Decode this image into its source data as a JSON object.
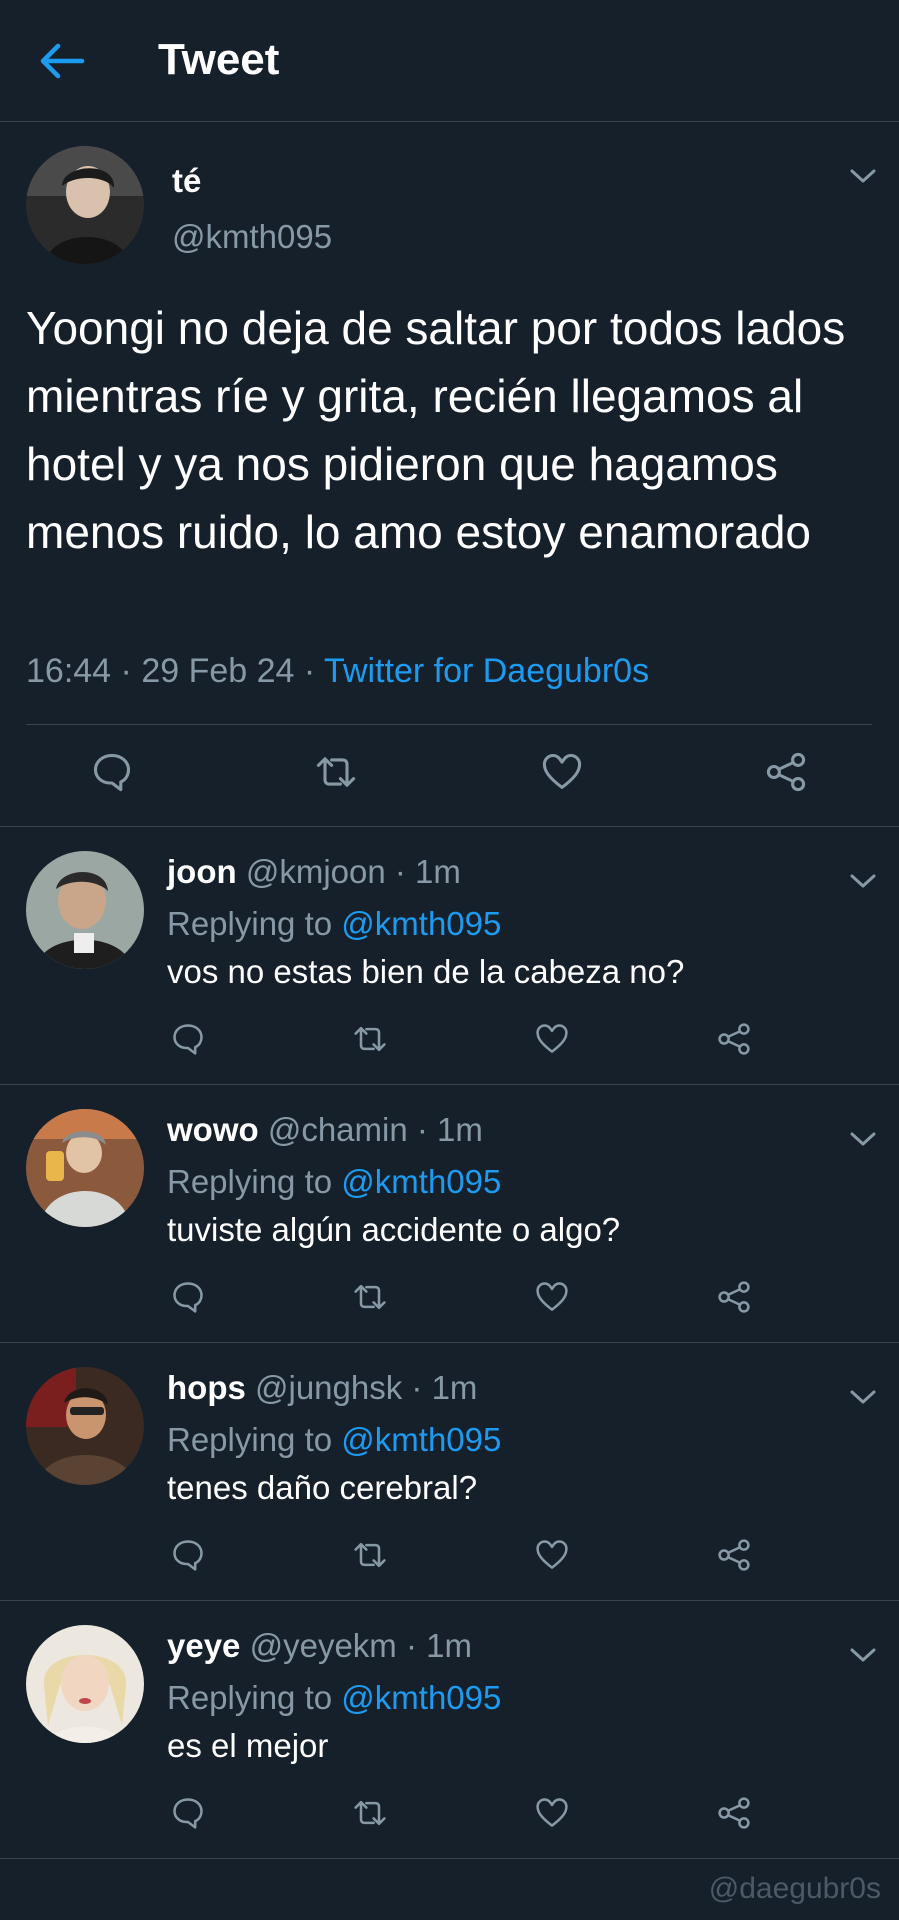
{
  "header": {
    "title": "Tweet",
    "back_icon": "arrow-left-icon",
    "accent": "#1d9bf0"
  },
  "main_tweet": {
    "display_name": "té",
    "handle": "@kmth095",
    "text": "Yoongi no deja de saltar por todos lados mientras ríe y grita, recién llegamos al hotel y ya nos pidieron que hagamos menos ruido, lo amo estoy enamorado",
    "time": "16:44",
    "sep1": " · ",
    "date": "29 Feb 24",
    "sep2": " · ",
    "source": "Twitter for Daegubr0s"
  },
  "replies": [
    {
      "display_name": "joon",
      "handle": "@kmjoon",
      "time": "· 1m",
      "replying_label": "Replying to",
      "mention": "@kmth095",
      "text": "vos no estas bien de la cabeza no?"
    },
    {
      "display_name": "wowo",
      "handle": "@chamin",
      "time": "· 1m",
      "replying_label": "Replying to",
      "mention": "@kmth095",
      "text": "tuviste algún accidente o algo?"
    },
    {
      "display_name": "hops",
      "handle": "@junghsk",
      "time": "· 1m",
      "replying_label": "Replying to",
      "mention": "@kmth095",
      "text": "tenes daño cerebral?"
    },
    {
      "display_name": "yeye",
      "handle": "@yeyekm",
      "time": "· 1m",
      "replying_label": "Replying to",
      "mention": "@kmth095",
      "text": "es el mejor"
    }
  ],
  "action_icons": [
    "reply-icon",
    "retweet-icon",
    "like-icon",
    "share-icon"
  ],
  "watermark": "@daegubr0s",
  "colors": {
    "background": "#15202b",
    "secondary_text": "#8899a6",
    "link": "#1d9bf0",
    "divider": "#38444d"
  }
}
